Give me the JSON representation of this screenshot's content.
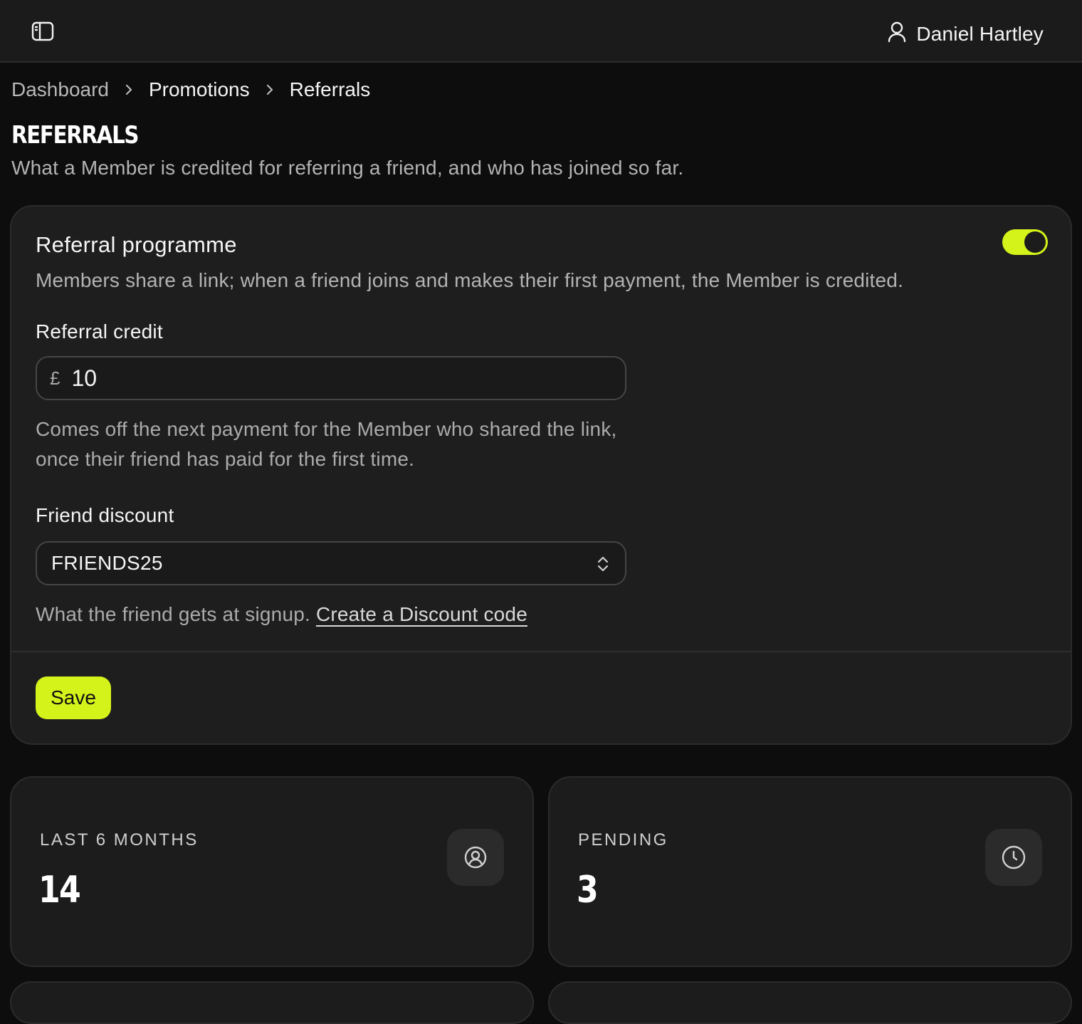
{
  "header": {
    "sidebar_toggle_icon": "sidebar-panel-icon",
    "user_icon": "user-icon",
    "user_name": "Daniel Hartley"
  },
  "breadcrumb": [
    {
      "label": "Dashboard"
    },
    {
      "label": "Promotions"
    },
    {
      "label": "Referrals"
    }
  ],
  "page": {
    "title": "REFERRALS",
    "subtitle": "What a Member is credited for referring a friend, and who has joined so far."
  },
  "programme_card": {
    "title": "Referral programme",
    "enabled": true,
    "description": "Members share a link; when a friend joins and makes their first payment, the Member is credited.",
    "credit": {
      "label": "Referral credit",
      "currency_symbol": "£",
      "value": "10",
      "help": "Comes off the next payment for the Member who shared the link, once their friend has paid for the first time."
    },
    "discount": {
      "label": "Friend discount",
      "selected": "FRIENDS25",
      "help": "What the friend gets at signup.",
      "link_label": "Create a Discount code"
    },
    "save_label": "Save"
  },
  "stats": [
    {
      "label": "LAST 6 MONTHS",
      "value": "14",
      "icon": "referral-user-icon"
    },
    {
      "label": "PENDING",
      "value": "3",
      "icon": "clock-icon"
    }
  ],
  "colors": {
    "accent": "#d4f31a",
    "background": "#0d0d0d",
    "card": "#1e1e1e"
  }
}
